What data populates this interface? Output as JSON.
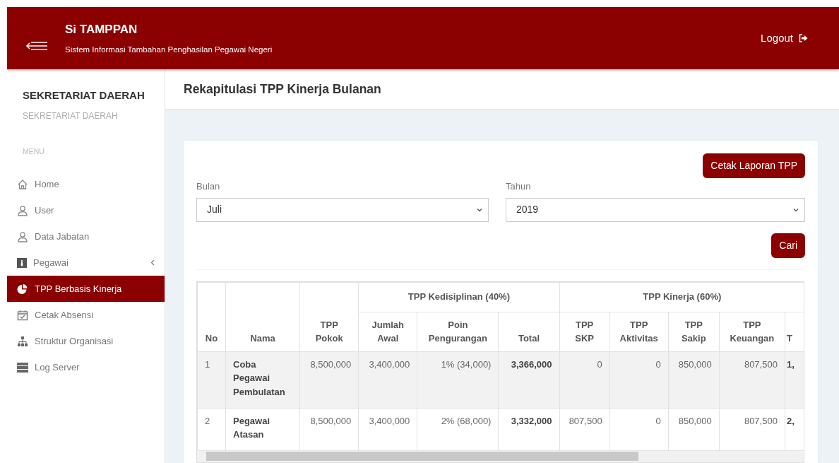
{
  "header": {
    "title": "Si TAMPPAN",
    "subtitle": "Sistem Informasi Tambahan Penghasilan Pegawai Negeri",
    "logout": "Logout"
  },
  "sidebar": {
    "org_name": "SEKRETARIAT DAERAH",
    "org_subtitle": "SEKRETARIAT DAERAH",
    "menu_label": "MENU",
    "items": [
      {
        "label": "Home",
        "selected": false,
        "submenu": false
      },
      {
        "label": "User",
        "selected": false,
        "submenu": false
      },
      {
        "label": "Data Jabatan",
        "selected": false,
        "submenu": false
      },
      {
        "label": "Pegawai",
        "selected": false,
        "submenu": true
      },
      {
        "label": "TPP Berbasis Kinerja",
        "selected": true,
        "submenu": false
      },
      {
        "label": "Cetak Absensi",
        "selected": false,
        "submenu": false
      },
      {
        "label": "Struktur Organisasi",
        "selected": false,
        "submenu": false
      },
      {
        "label": "Log Server",
        "selected": false,
        "submenu": false
      }
    ]
  },
  "page_title": "Rekapitulasi TPP Kinerja Bulanan",
  "print_button": "Cetak Laporan TPP",
  "filters": [
    {
      "label": "Bulan",
      "value": "Juli"
    },
    {
      "label": "Tahun",
      "value": "2019"
    }
  ],
  "search_button": "Cari",
  "table": {
    "header": [
      {
        "label": "No"
      },
      {
        "label": "Nama"
      },
      {
        "label": "TPP Pokok"
      },
      {
        "label": "TPP Kedisiplinan (40%)",
        "children": [
          "Jumlah Awal",
          "Poin Pengurangan",
          "Total"
        ]
      },
      {
        "label": "TPP Kinerja (60%)",
        "children": [
          "TPP SKP",
          "TPP Aktivitas",
          "TPP Sakip",
          "TPP Keuangan",
          "T"
        ]
      }
    ],
    "rows": [
      {
        "cells": [
          "1",
          "Coba Pegawai Pembulatan",
          "8,500,000",
          "3,400,000",
          "1% (34,000)",
          "3,366,000",
          "0",
          "0",
          "850,000",
          "807,500",
          "1,"
        ]
      },
      {
        "cells": [
          "2",
          "Pegawai Atasan",
          "8,500,000",
          "3,400,000",
          "2% (68,000)",
          "3,332,000",
          "807,500",
          "0",
          "850,000",
          "807,500",
          "2,"
        ]
      }
    ]
  }
}
